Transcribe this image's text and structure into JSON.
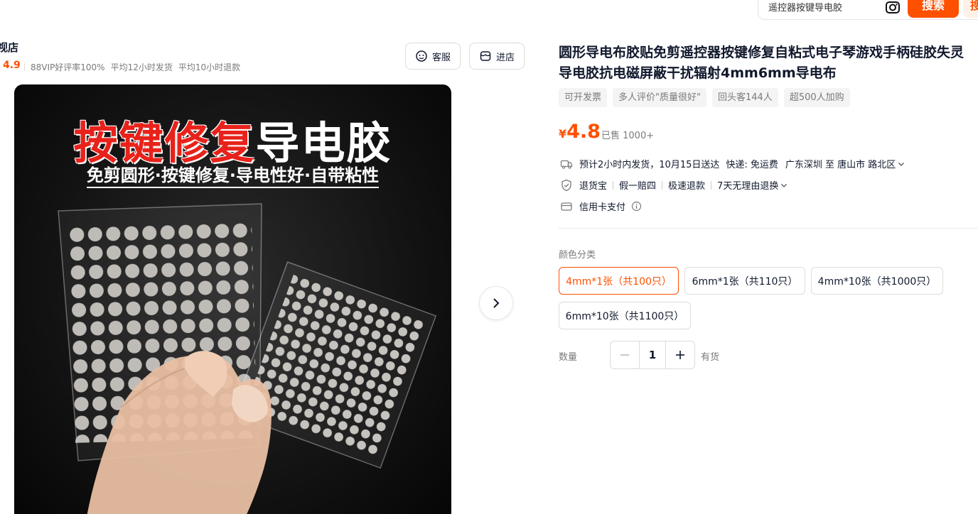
{
  "search": {
    "placeholder": "遥控器按键导电胶",
    "button_label": "搜索",
    "button2_label": "搜"
  },
  "shop": {
    "name": "视店",
    "rating": "4.9",
    "stats": [
      "88VIP好评率100%",
      "平均12小时发货",
      "平均10小时退款"
    ],
    "service_label": "客服",
    "enter_label": "进店"
  },
  "image": {
    "title_red": "按键修复",
    "title_white": "导电胶",
    "subtitle": "免剪圆形·按键修复·导电性好·自带粘性"
  },
  "product": {
    "title_line1": "圆形导电布胶贴免剪遥控器按键修复自粘式电子琴游戏手柄硅胶失灵",
    "title_line2": "导电胶抗电磁屏蔽干扰辐射4mm6mm导电布",
    "tags": [
      "可开发票",
      "多人评价\"质量很好\"",
      "回头客144人",
      "超500人加购"
    ],
    "price_symbol": "¥",
    "price": "4.8",
    "sold": "已售 1000+"
  },
  "delivery": {
    "text": "预计2小时内发货，10月15日送达",
    "shipping": "快递: 免运费",
    "route": "广东深圳 至 唐山市 路北区"
  },
  "guarantees": [
    "退货宝",
    "假一赔四",
    "极速退款",
    "7天无理由退换"
  ],
  "payment": "信用卡支付",
  "options": {
    "label": "颜色分类",
    "items": [
      "4mm*1张（共100只）",
      "6mm*1张（共110只）",
      "4mm*10张（共1000只）",
      "6mm*10张（共1100只）"
    ],
    "selected_index": 0
  },
  "quantity": {
    "label": "数量",
    "value": "1",
    "stock": "有货"
  },
  "colors": {
    "accent": "#ff5000",
    "title_red": "#e8221b"
  }
}
